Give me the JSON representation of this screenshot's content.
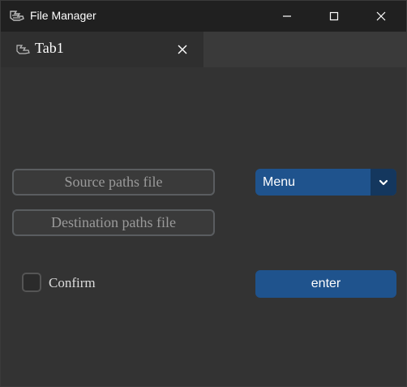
{
  "window": {
    "title": "File Manager",
    "icon": "app-logo-icon",
    "controls": [
      "minimize-icon",
      "maximize-icon",
      "close-icon"
    ]
  },
  "tabs": [
    {
      "label": "Tab1",
      "icon": "app-logo-icon",
      "close_icon": "close-icon"
    }
  ],
  "main": {
    "source_button_label": "Source paths file",
    "destination_button_label": "Destination paths file",
    "menu": {
      "selected": "Menu",
      "arrow_icon": "chevron-down-icon"
    },
    "confirm_label": "Confirm",
    "confirm_checked": false,
    "enter_button_label": "enter"
  },
  "colors": {
    "accent": "#1f538d",
    "accent_dark": "#14375e",
    "background": "#333333",
    "titlebar": "#202020"
  }
}
